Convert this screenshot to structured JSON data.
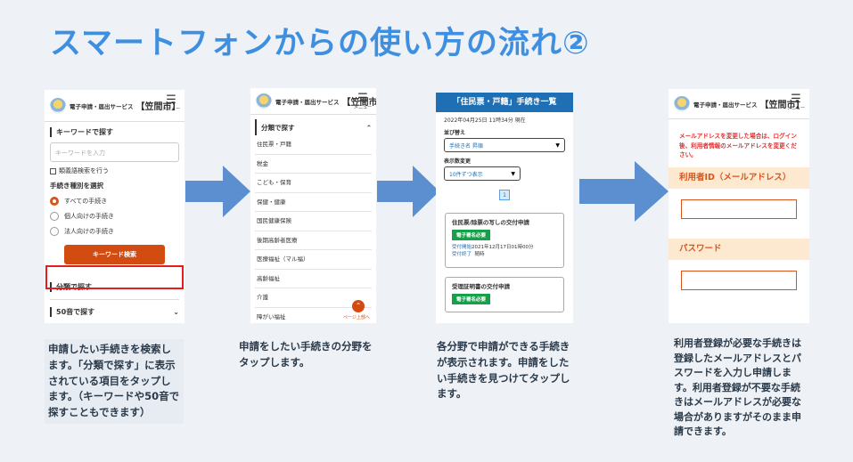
{
  "title": "スマートフォンからの使い方の流れ②",
  "header": {
    "service": "電子申請・届出サービス",
    "city": "【笠間市】",
    "menu_label": "メニュー"
  },
  "phone1": {
    "keyword_section": "キーワードで探す",
    "keyword_placeholder": "キーワードを入力",
    "synonym_checkbox": "類義語検索を行う",
    "type_label": "手続き種別を選択",
    "radios": [
      "すべての手続き",
      "個人向けの手続き",
      "法人向けの手続き"
    ],
    "search_button": "キーワード検索",
    "category_accordion": "分類で探す",
    "syllabary_accordion": "50音で探す"
  },
  "phone2": {
    "category_header": "分類で探す",
    "categories": [
      "住民票・戸籍",
      "税金",
      "こども・保育",
      "保健・健康",
      "国民健康保険",
      "後期高齢者医療",
      "医療福祉（マル福）",
      "高齢福祉",
      "介護",
      "障がい福祉"
    ],
    "to_top": "ページ上部へ"
  },
  "phone3": {
    "title": "「住民票・戸籍」手続き一覧",
    "timestamp": "2022年04月25日 11時34分 現在",
    "sort_label": "並び替え",
    "sort_value": "手続き名 昇順",
    "count_label": "表示数変更",
    "count_value": "10件ずつ表示",
    "page": "1",
    "cards": [
      {
        "title": "住民票/除票の写しの交付申請",
        "badge": "電子署名必要",
        "start_label": "受付開始",
        "start": "2021年12月17日01時00分",
        "end_label": "受付終了",
        "end": "随時"
      },
      {
        "title": "受理証明書の交付申請",
        "badge": "電子署名必要"
      }
    ]
  },
  "phone4": {
    "warning": "メールアドレスを変更した場合は、ログイン後、利用者情報のメールアドレスを変更ください。",
    "userid_label": "利用者ID（メールアドレス）",
    "password_label": "パスワード"
  },
  "captions": [
    "申請したい手続きを検索します。「分類で探す」に表示されている項目をタップします。（キーワードや50音で探すこともできます）",
    "申請をしたい手続きの分野をタップします。",
    "各分野で申請ができる手続きが表示されます。申請をしたい手続きを見つけてタップします。",
    "利用者登録が必要な手続きは登録したメールアドレスとパスワードを入力し申請します。利用者登録が不要な手続きはメールアドレスが必要な場合がありますがそのまま申請できます。"
  ]
}
